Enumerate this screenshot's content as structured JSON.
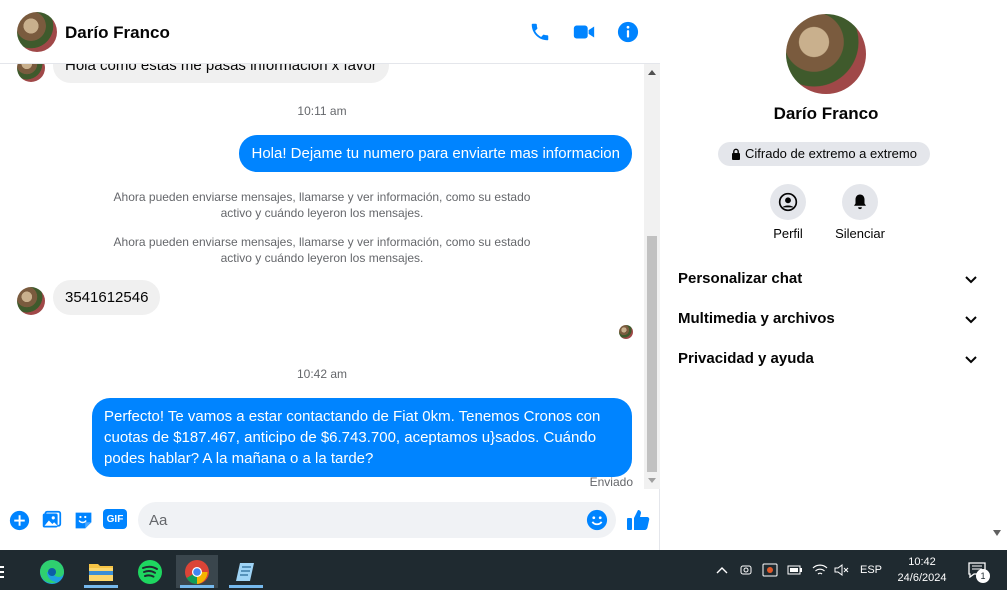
{
  "header": {
    "contact_name": "Darío Franco"
  },
  "messages": {
    "partial_incoming": "Hola como estas me pasas informacion x favor",
    "time_1": "10:11 am",
    "outgoing_1": "Hola! Dejame tu numero para enviarte mas informacion",
    "system_1": "Ahora pueden enviarse mensajes, llamarse y ver información, como su estado activo y cuándo leyeron los mensajes.",
    "system_2": "Ahora pueden enviarse mensajes, llamarse y ver información, como su estado activo y cuándo leyeron los mensajes.",
    "incoming_number": "3541612546",
    "time_2": "10:42 am",
    "outgoing_2": "Perfecto! Te vamos a estar contactando de Fiat 0km. Tenemos Cronos con cuotas de $187.467, anticipo de $6.743.700, aceptamos u}sados. Cuándo podes hablar? A la mañana o a la tarde?",
    "status": "Enviado"
  },
  "composer": {
    "placeholder": "Aa",
    "gif_label": "GIF"
  },
  "info": {
    "name": "Darío Franco",
    "encryption": "Cifrado de extremo a extremo",
    "profile_label": "Perfil",
    "mute_label": "Silenciar",
    "sections": [
      "Personalizar chat",
      "Multimedia y archivos",
      "Privacidad y ayuda"
    ]
  },
  "taskbar": {
    "language": "ESP",
    "time": "10:42",
    "date": "24/6/2024",
    "notification_count": "1"
  },
  "colors": {
    "accent": "#0084ff",
    "incoming_bubble": "#f0f0f0",
    "taskbar": "#1f2a30"
  }
}
